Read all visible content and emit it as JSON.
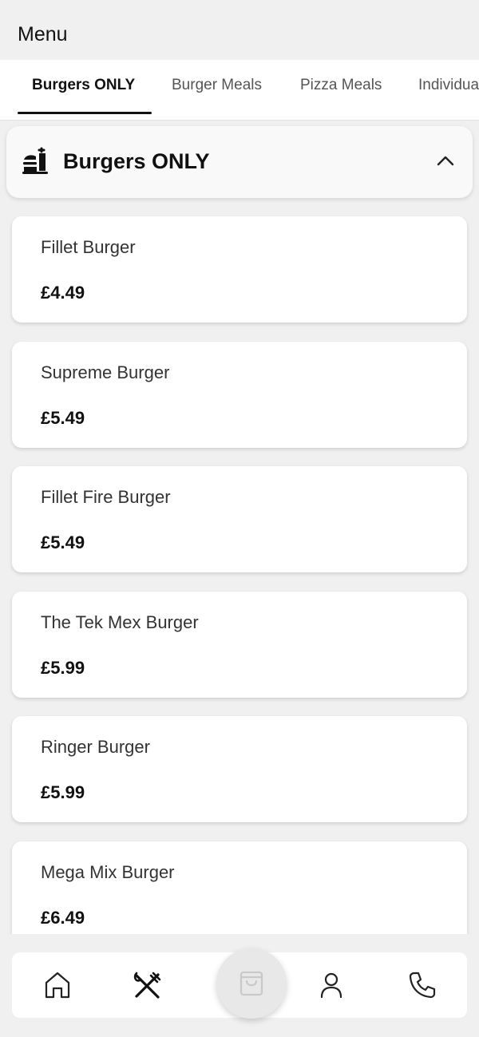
{
  "header": {
    "title": "Menu"
  },
  "tabs": [
    {
      "label": "Burgers ONLY",
      "active": true
    },
    {
      "label": "Burger Meals",
      "active": false
    },
    {
      "label": "Pizza Meals",
      "active": false
    },
    {
      "label": "Individua",
      "active": false
    }
  ],
  "section": {
    "title": "Burgers ONLY",
    "icon": "food-tray-icon",
    "expanded": true
  },
  "items": [
    {
      "name": "Fillet Burger",
      "price": "£4.49"
    },
    {
      "name": "Supreme Burger",
      "price": "£5.49"
    },
    {
      "name": "Fillet Fire Burger",
      "price": "£5.49"
    },
    {
      "name": "The Tek Mex Burger",
      "price": "£5.99"
    },
    {
      "name": "Ringer Burger",
      "price": "£5.99"
    },
    {
      "name": "Mega Mix Burger",
      "price": "£6.49"
    }
  ],
  "bottom_nav": {
    "items": [
      {
        "icon": "home-icon"
      },
      {
        "icon": "utensils-icon",
        "active": true
      },
      {
        "icon": "shopping-bag-icon"
      },
      {
        "icon": "user-icon"
      },
      {
        "icon": "phone-icon"
      }
    ]
  },
  "colors": {
    "background": "#f1f0f0",
    "card": "#ffffff",
    "text_primary": "#111111",
    "text_secondary": "#555555",
    "fab": "#e8e8e8"
  }
}
